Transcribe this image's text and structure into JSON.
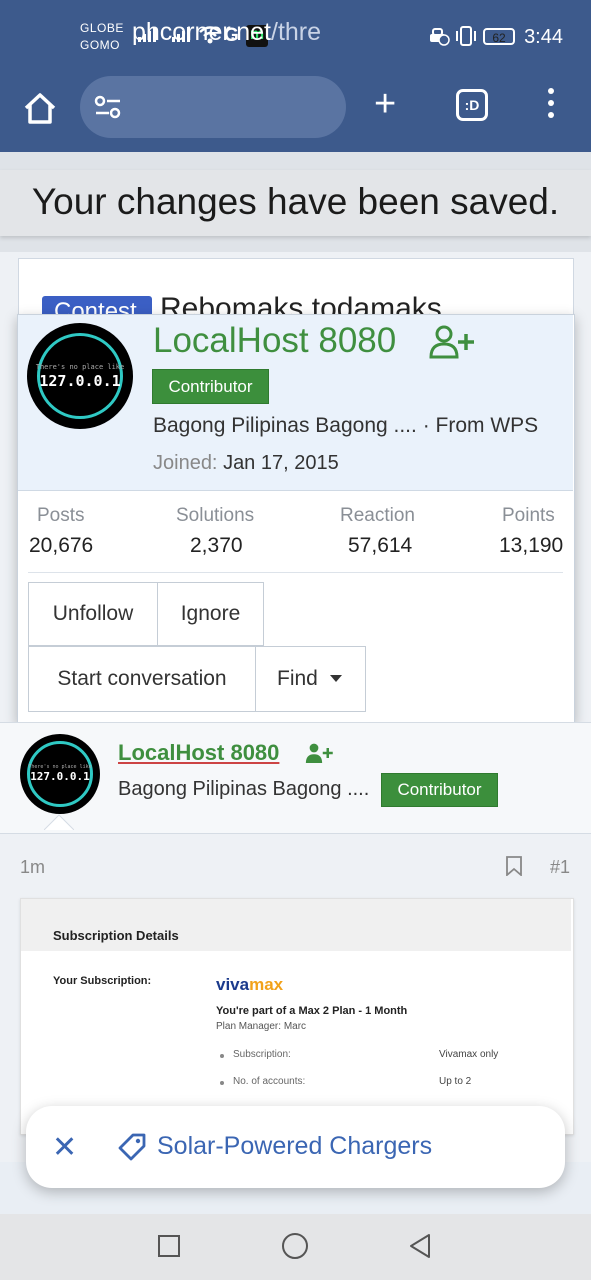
{
  "status_bar": {
    "carrier_line1": "GLOBE",
    "carrier_line2": "GOMO",
    "network_g": "G",
    "app_badge": "m",
    "battery": "62",
    "time": "3:44"
  },
  "browser": {
    "url_main": "phcorner.net",
    "url_rest": "/thre",
    "tabs_label": ":D"
  },
  "toast": {
    "message": "Your changes have been saved."
  },
  "thread": {
    "prefix": "Contest",
    "title_partial": "Rebomaks todamaks"
  },
  "avatar": {
    "caption": "There's no place like",
    "ip": "127.0.0.1"
  },
  "member_popup": {
    "name": "LocalHost 8080",
    "badge": "Contributor",
    "tagline": "Bagong Pilipinas Bagong .... · From WPS",
    "joined_label": "Joined:",
    "joined_value": "Jan 17, 2015",
    "stats": [
      {
        "label": "Posts",
        "value": "20,676"
      },
      {
        "label": "Solutions",
        "value": "2,370"
      },
      {
        "label": "Reaction",
        "value": "57,614"
      },
      {
        "label": "Points",
        "value": "13,190"
      }
    ],
    "buttons": {
      "unfollow": "Unfollow",
      "ignore": "Ignore",
      "start_conversation": "Start conversation",
      "find": "Find"
    }
  },
  "post": {
    "author_name": "LocalHost 8080",
    "author_tagline": "Bagong Pilipinas Bagong ....",
    "author_badge": "Contributor",
    "time": "1m",
    "number": "#1"
  },
  "embedded_image": {
    "heading": "Subscription Details",
    "your_subscription_label": "Your Subscription:",
    "brand_viva": "viva",
    "brand_max": "max",
    "plan": "You're part of a Max 2 Plan - 1 Month",
    "manager": "Plan Manager: Marc",
    "rows": [
      {
        "label": "Subscription:",
        "value": "Vivamax only"
      },
      {
        "label": "No. of accounts:",
        "value": "Up to 2"
      }
    ]
  },
  "suggestion_chip": {
    "close": "✕",
    "text": "Solar-Powered Chargers"
  },
  "colors": {
    "browser_bar": "#3d5a8c",
    "username_green": "#3f8f3f",
    "contributor_badge": "#3c8f3c",
    "chip_text": "#3b66b3"
  }
}
